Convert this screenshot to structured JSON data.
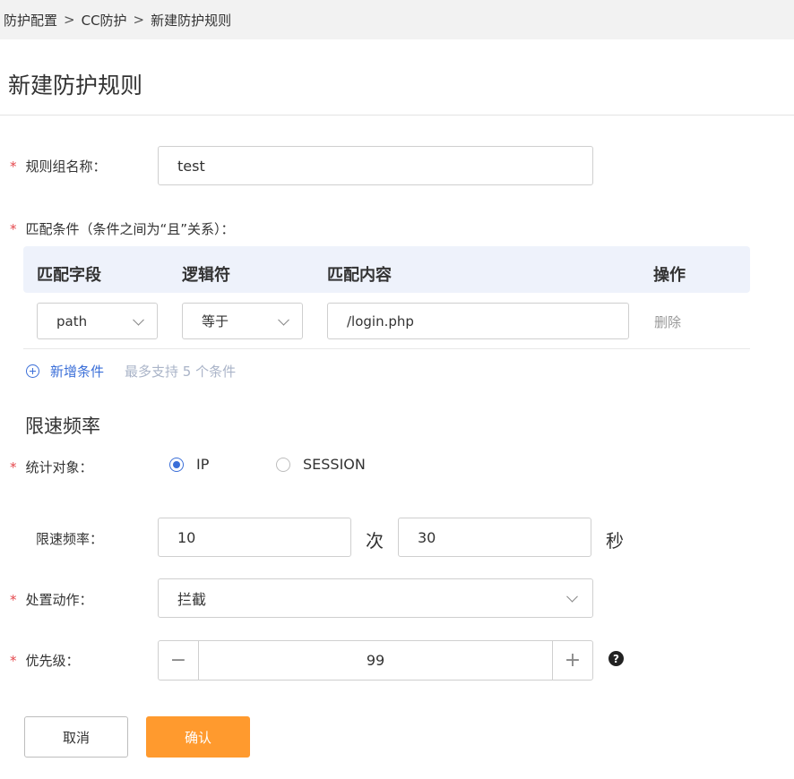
{
  "breadcrumb": {
    "items": [
      "防护配置",
      "CC防护",
      "新建防护规则"
    ],
    "separator": ">"
  },
  "page_title": "新建防护规则",
  "required_mark": "*",
  "rule_group": {
    "label": "规则组名称：",
    "value": "test"
  },
  "match": {
    "label": "匹配条件（条件之间为“且”关系）：",
    "columns": [
      "匹配字段",
      "逻辑符",
      "匹配内容",
      "操作"
    ],
    "rows": [
      {
        "field": "path",
        "operator": "等于",
        "content": "/login.php",
        "action": "删除"
      }
    ],
    "add_label": "新增条件",
    "hint": "最多支持 5 个条件"
  },
  "rate_section": {
    "title": "限速频率",
    "target_label": "统计对象：",
    "target_options": [
      {
        "label": "IP",
        "selected": true
      },
      {
        "label": "SESSION",
        "selected": false
      }
    ],
    "rate_label": "限速频率：",
    "count_value": "10",
    "count_unit": "次",
    "period_value": "30",
    "period_unit": "秒"
  },
  "action": {
    "label": "处置动作：",
    "value": "拦截"
  },
  "priority": {
    "label": "优先级：",
    "value": "99",
    "minus": "−",
    "plus": "+",
    "help": "?"
  },
  "buttons": {
    "cancel": "取消",
    "confirm": "确认"
  },
  "colors": {
    "accent": "#3b6fd8",
    "primary_button": "#ff9a2e",
    "required": "#e5484d",
    "table_header_bg": "#eef2fb"
  }
}
